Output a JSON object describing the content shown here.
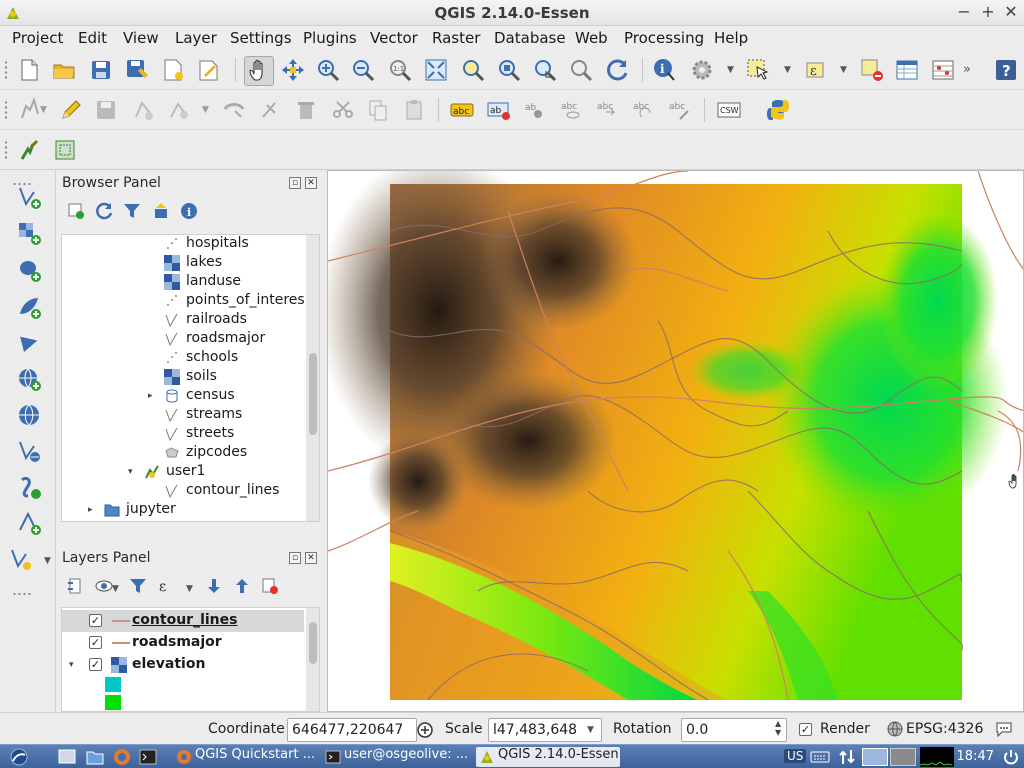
{
  "window": {
    "title": "QGIS 2.14.0-Essen",
    "controls": [
      "−",
      "+",
      "✕"
    ]
  },
  "menu": [
    "Project",
    "Edit",
    "View",
    "Layer",
    "Settings",
    "Plugins",
    "Vector",
    "Raster",
    "Database",
    "Web",
    "Processing",
    "Help"
  ],
  "browser_panel": {
    "title": "Browser Panel",
    "items": [
      {
        "label": "hospitals",
        "icon": "point-layer-icon"
      },
      {
        "label": "lakes",
        "icon": "raster-layer-icon"
      },
      {
        "label": "landuse",
        "icon": "raster-layer-icon"
      },
      {
        "label": "points_of_interes",
        "icon": "point-layer-icon"
      },
      {
        "label": "railroads",
        "icon": "line-layer-icon"
      },
      {
        "label": "roadsmajor",
        "icon": "line-layer-icon"
      },
      {
        "label": "schools",
        "icon": "point-layer-icon"
      },
      {
        "label": "soils",
        "icon": "raster-layer-icon"
      },
      {
        "label": "census",
        "icon": "database-icon",
        "expander": "▸"
      },
      {
        "label": "streams",
        "icon": "line-layer-icon"
      },
      {
        "label": "streets",
        "icon": "line-layer-icon"
      },
      {
        "label": "zipcodes",
        "icon": "polygon-layer-icon"
      },
      {
        "label": "user1",
        "icon": "grass-mapset-icon",
        "expander": "▾"
      },
      {
        "label": "contour_lines",
        "icon": "line-layer-icon"
      },
      {
        "label": "jupyter",
        "icon": "folder-icon",
        "expander": "▸"
      }
    ]
  },
  "layers_panel": {
    "title": "Layers Panel",
    "layers": [
      {
        "label": "contour_lines",
        "checked": "✓",
        "symbol": "line",
        "selected": true
      },
      {
        "label": "roadsmajor",
        "checked": "✓",
        "symbol": "line"
      },
      {
        "label": "elevation",
        "checked": "✓",
        "symbol": "raster",
        "expander": "▾"
      }
    ],
    "legend_colors": [
      "#00c8c8",
      "#00e000"
    ]
  },
  "status": {
    "coordinate_label": "Coordinate",
    "coordinate_value": "646477,220647",
    "scale_label": "Scale",
    "scale_value": "l47,483,648",
    "rotation_label": "Rotation",
    "rotation_value": "0.0",
    "render_label": "Render",
    "render_checked": "✓",
    "crs": "EPSG:4326"
  },
  "taskbar": {
    "items": [
      {
        "label": "QGIS Quickstart ...",
        "icon": "firefox-icon"
      },
      {
        "label": "user@osgeolive: ...",
        "icon": "terminal-icon"
      },
      {
        "label": "QGIS 2.14.0-Essen",
        "icon": "qgis-icon",
        "active": true
      }
    ],
    "keyboard_layout": "US",
    "clock": "18:47"
  },
  "colors": {
    "elevation_low": "#00d838",
    "elevation_mid": "#f0e000",
    "elevation_high": "#ef8a10",
    "elevation_peak": "#1a1410",
    "contour": "#8a6a6a",
    "roads": "#d08060"
  }
}
